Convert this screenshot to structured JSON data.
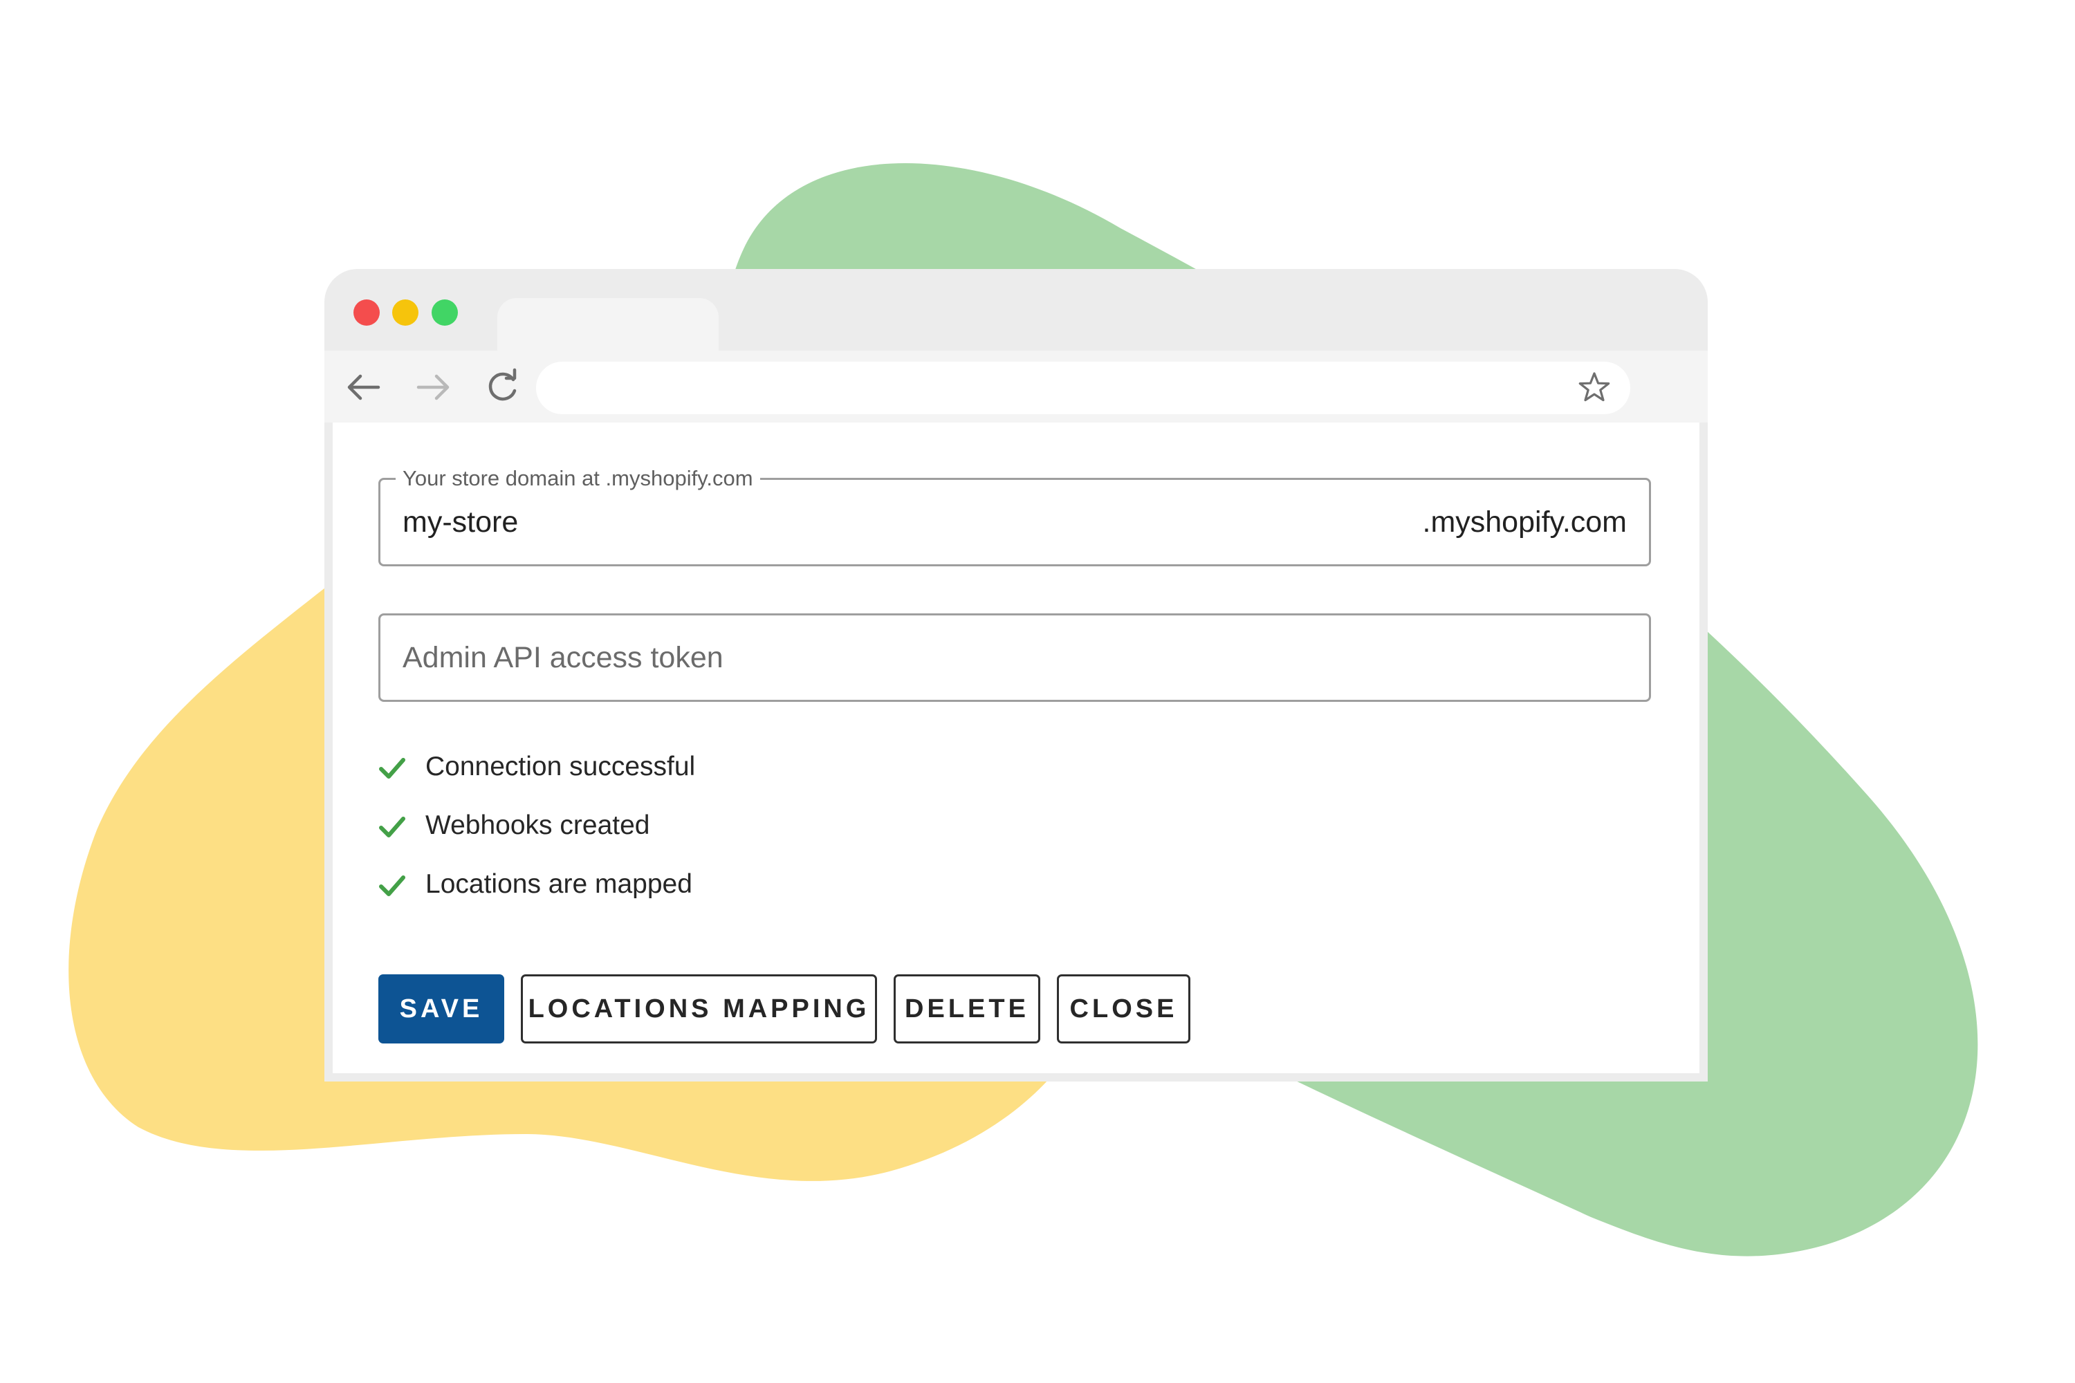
{
  "form": {
    "domain_field": {
      "label": "Your store domain at .myshopify.com",
      "value": "my-store",
      "suffix": ".myshopify.com"
    },
    "token_field": {
      "placeholder": "Admin API access token"
    },
    "status_items": [
      {
        "label": "Connection successful",
        "icon": "check-icon",
        "state": "success"
      },
      {
        "label": "Webhooks created",
        "icon": "check-icon",
        "state": "success"
      },
      {
        "label": "Locations are mapped",
        "icon": "check-icon",
        "state": "success"
      }
    ],
    "buttons": {
      "save": "SAVE",
      "locations_mapping": "LOCATIONS MAPPING",
      "delete": "DELETE",
      "close": "CLOSE"
    }
  },
  "browser": {
    "icons": [
      "back-arrow-icon",
      "forward-arrow-icon",
      "reload-icon",
      "star-icon"
    ],
    "window_controls": [
      "close",
      "minimize",
      "maximize"
    ]
  },
  "colors": {
    "primary_button": "#0d5494",
    "success_check": "#43a047",
    "blob_green": "#a7d7a7",
    "blob_yellow": "#fddf84",
    "window_chrome": "#ececec"
  }
}
